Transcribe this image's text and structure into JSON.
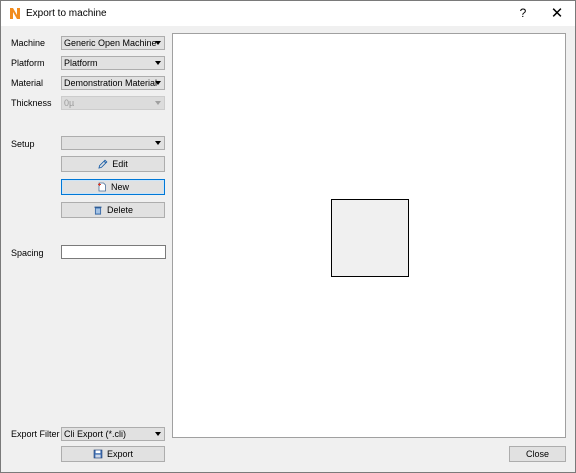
{
  "window": {
    "title": "Export to machine",
    "help_label": "?",
    "close_glyph": "✕",
    "app_icon": "n-logo-icon",
    "accent_color": "#0078d7"
  },
  "form": {
    "machine": {
      "label": "Machine",
      "value": "Generic Open Machine"
    },
    "platform": {
      "label": "Platform",
      "value": "Platform"
    },
    "material": {
      "label": "Material",
      "value": "Demonstration Material"
    },
    "thickness": {
      "label": "Thickness",
      "value": "0µ"
    },
    "setup": {
      "label": "Setup",
      "value": ""
    },
    "spacing": {
      "label": "Spacing",
      "value": ""
    },
    "export_filter": {
      "label": "Export Filter",
      "value": "Cli Export (*.cli)"
    }
  },
  "buttons": {
    "edit": "Edit",
    "new": "New",
    "delete": "Delete",
    "export": "Export",
    "close": "Close"
  }
}
